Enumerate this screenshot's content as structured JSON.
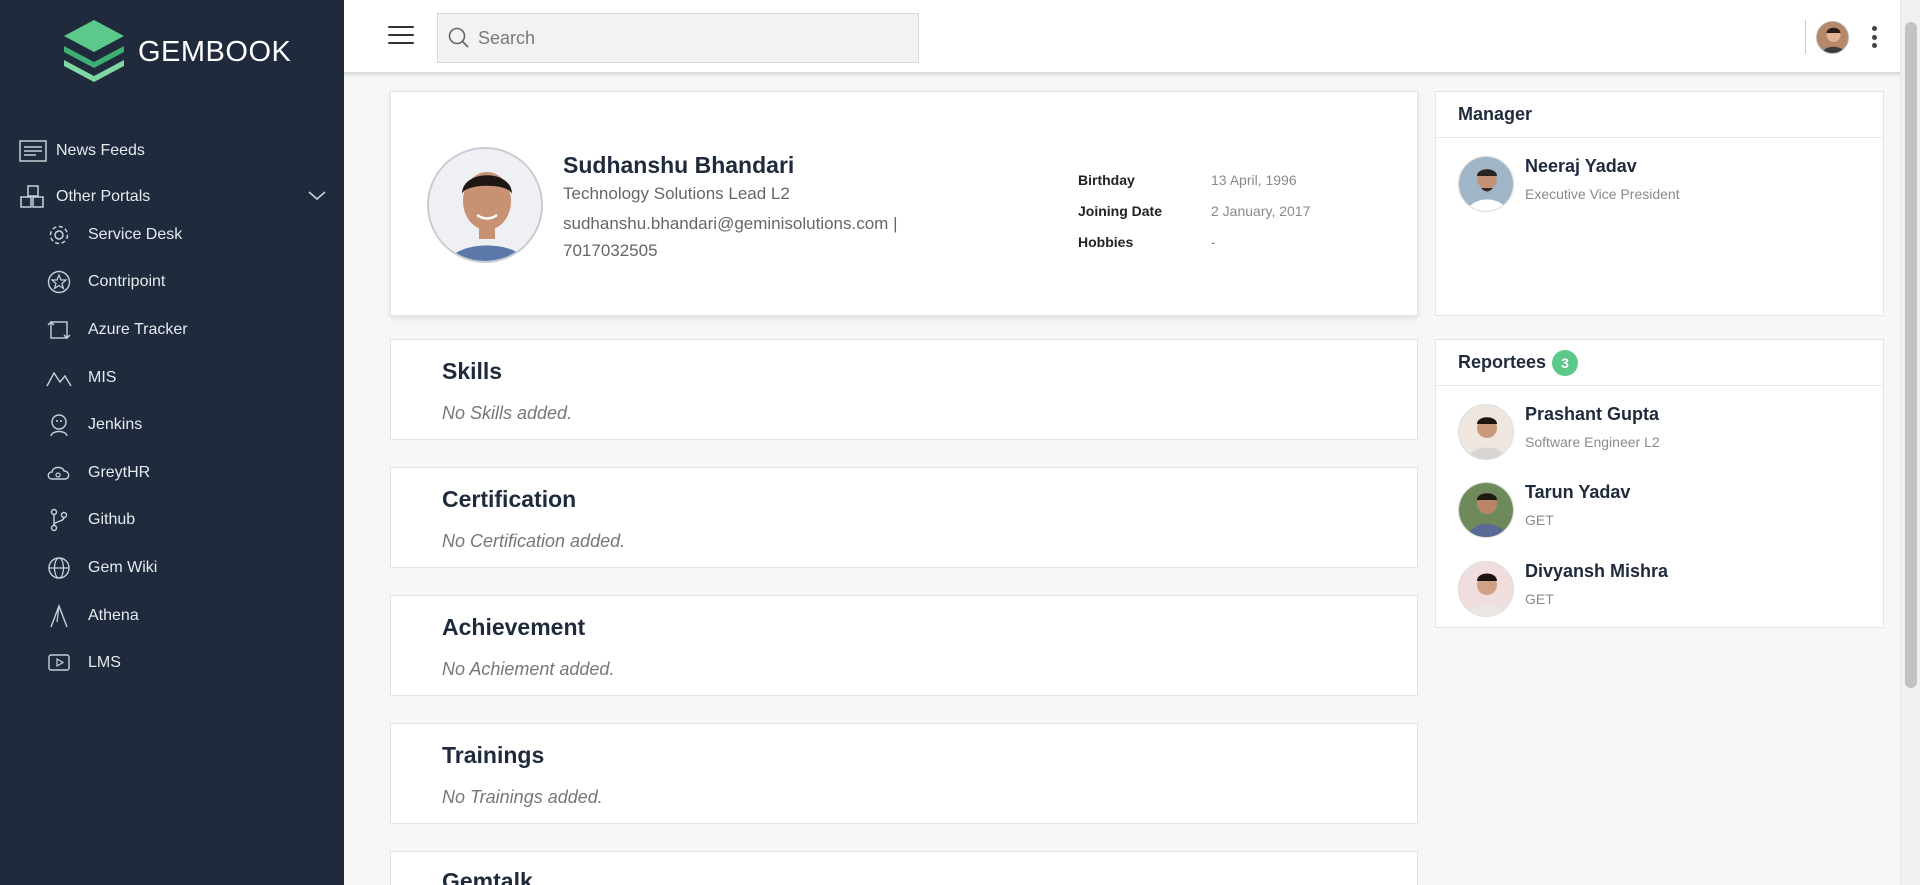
{
  "brand": {
    "name": "GEMBOOK"
  },
  "sidebar": {
    "top_items": [
      {
        "label": "News Feeds",
        "icon": "news-feed-icon"
      },
      {
        "label": "Other Portals",
        "icon": "portals-icon"
      }
    ],
    "portals": [
      {
        "label": "Service Desk",
        "icon": "gear-icon"
      },
      {
        "label": "Contripoint",
        "icon": "star-badge-icon"
      },
      {
        "label": "Azure Tracker",
        "icon": "tracker-icon"
      },
      {
        "label": "MIS",
        "icon": "chart-icon"
      },
      {
        "label": "Jenkins",
        "icon": "jenkins-icon"
      },
      {
        "label": "GreytHR",
        "icon": "cloud-icon"
      },
      {
        "label": "Github",
        "icon": "git-branch-icon"
      },
      {
        "label": "Gem Wiki",
        "icon": "globe-icon"
      },
      {
        "label": "Athena",
        "icon": "athena-icon"
      },
      {
        "label": "LMS",
        "icon": "play-icon"
      }
    ]
  },
  "header": {
    "search_placeholder": "Search"
  },
  "profile": {
    "name": "Sudhanshu Bhandari",
    "role": "Technology Solutions Lead L2",
    "email": "sudhanshu.bhandari@geminisolutions.com",
    "separator": "|",
    "phone": "7017032505",
    "details": [
      {
        "label": "Birthday",
        "value": "13 April, 1996"
      },
      {
        "label": "Joining Date",
        "value": "2 January, 2017"
      },
      {
        "label": "Hobbies",
        "value": "-"
      }
    ]
  },
  "sections": [
    {
      "title": "Skills",
      "empty_text": "No Skills added."
    },
    {
      "title": "Certification",
      "empty_text": "No Certification added."
    },
    {
      "title": "Achievement",
      "empty_text": "No Achiement added."
    },
    {
      "title": "Trainings",
      "empty_text": "No Trainings added."
    },
    {
      "title": "Gemtalk",
      "empty_text": ""
    }
  ],
  "manager": {
    "title": "Manager",
    "name": "Neeraj Yadav",
    "role": "Executive Vice President"
  },
  "reportees": {
    "title": "Reportees",
    "count": "3",
    "people": [
      {
        "name": "Prashant Gupta",
        "role": "Software Engineer L2"
      },
      {
        "name": "Tarun Yadav",
        "role": "GET"
      },
      {
        "name": "Divyansh Mishra",
        "role": "GET"
      }
    ]
  },
  "colors": {
    "sidebar": "#1f2a3c",
    "accent_green": "#5cc98a"
  }
}
